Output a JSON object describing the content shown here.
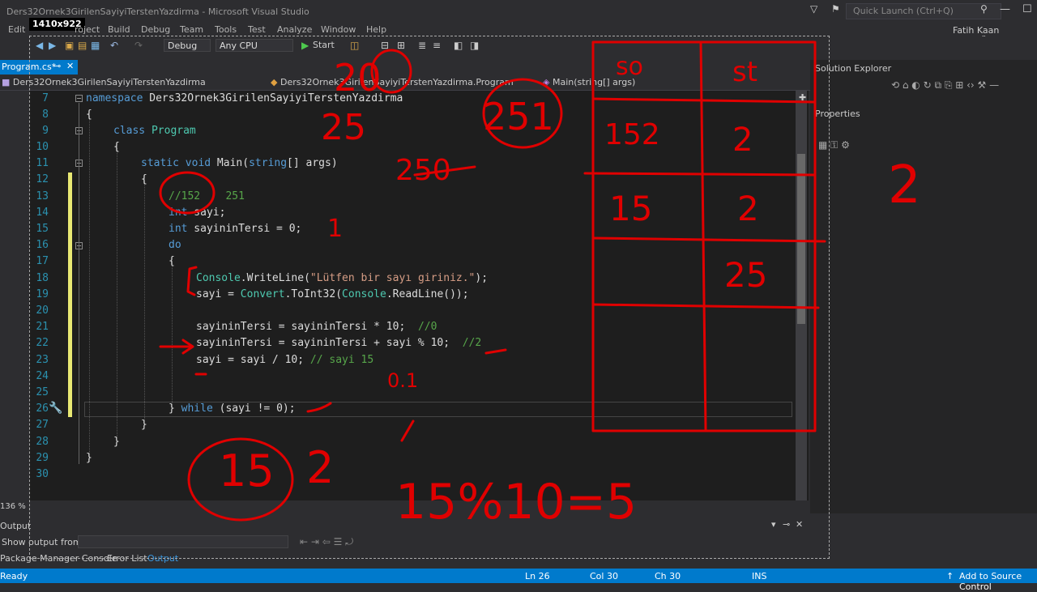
{
  "window": {
    "title": "Ders32Ornek3GirilenSayiyiTerstenYazdirma - Microsoft Visual Studio",
    "quick_launch_placeholder": "Quick Launch (Ctrl+Q)",
    "user": "Fatih Kaan AÇIKGÖZ",
    "capture_size_badge": "1410x922"
  },
  "menu": [
    "Edit",
    "roject",
    "Build",
    "Debug",
    "Team",
    "Tools",
    "Test",
    "Analyze",
    "Window",
    "Help"
  ],
  "toolbar": {
    "config": "Debug",
    "platform": "Any CPU",
    "start_label": "Start"
  },
  "tab": {
    "label": "Program.cs*"
  },
  "navbar": {
    "project": "Ders32Ornek3GirilenSayiyiTerstenYazdirma",
    "class": "Ders32Ornek3GirilenSayiyiTerstenYazdirma.Program",
    "member": "Main(string[] args)"
  },
  "code": {
    "line_numbers": [
      "7",
      "8",
      "9",
      "10",
      "11",
      "12",
      "13",
      "14",
      "15",
      "16",
      "17",
      "18",
      "19",
      "20",
      "21",
      "22",
      "23",
      "24",
      "25",
      "26",
      "27",
      "28",
      "29",
      "30"
    ],
    "lines": {
      "l7_kw": "namespace",
      "l7_name": " Ders32Ornek3GirilenSayiyiTerstenYazdirma",
      "l8": "{",
      "l9_kw": "class",
      "l9_name": "Program",
      "l10": "{",
      "l11_kw": "static void",
      "l11_fn": " Main(",
      "l11_ty": "string",
      "l11_rest": "[] args)",
      "l12": "{",
      "l13_cm": "//152    251",
      "l14_kw": "int",
      "l14_rest": " sayi;",
      "l15_kw": "int",
      "l15_rest": " sayininTersi = 0;",
      "l16_kw": "do",
      "l17": "{",
      "l18_ty": "Console",
      "l18_a": ".WriteLine(",
      "l18_str": "\"Lütfen bir sayı giriniz.\"",
      "l18_b": ");",
      "l19_a": "sayi = ",
      "l19_ty1": "Convert",
      "l19_b": ".ToInt32(",
      "l19_ty2": "Console",
      "l19_c": ".ReadLine());",
      "l21_a": "sayininTersi = sayininTersi * 10;  ",
      "l21_cm": "//0",
      "l22_a": "sayininTersi = sayininTersi + sayi % 10;  ",
      "l22_cm": "//2",
      "l23_a": "sayi = sayi / 10; ",
      "l23_cm": "// sayi 15",
      "l26_a": "} ",
      "l26_kw": "while",
      "l26_b": " (sayi != 0);",
      "l27": "}",
      "l28": "}",
      "l29": "}"
    }
  },
  "panels": {
    "solution_explorer": "Solution Explorer",
    "properties": "Properties",
    "zoom": "136 %",
    "output_title": "Output",
    "show_output_from": "Show output from:",
    "bottom_tabs": [
      "Package Manager Console",
      "Error List",
      "Output"
    ]
  },
  "status": {
    "ready": "Ready",
    "ln": "Ln 26",
    "col": "Col 30",
    "ch": "Ch 30",
    "ins": "INS",
    "source_control": "Add to Source Control"
  },
  "ink": {
    "color": "#e00000",
    "table_headers": [
      "so",
      "st"
    ],
    "table_cells": [
      "152",
      "2",
      "15",
      "2",
      "25"
    ],
    "annotations": [
      "20",
      "25",
      "251",
      "250",
      "1",
      "2",
      "0.1",
      "15",
      "2",
      "15%10=5"
    ]
  }
}
